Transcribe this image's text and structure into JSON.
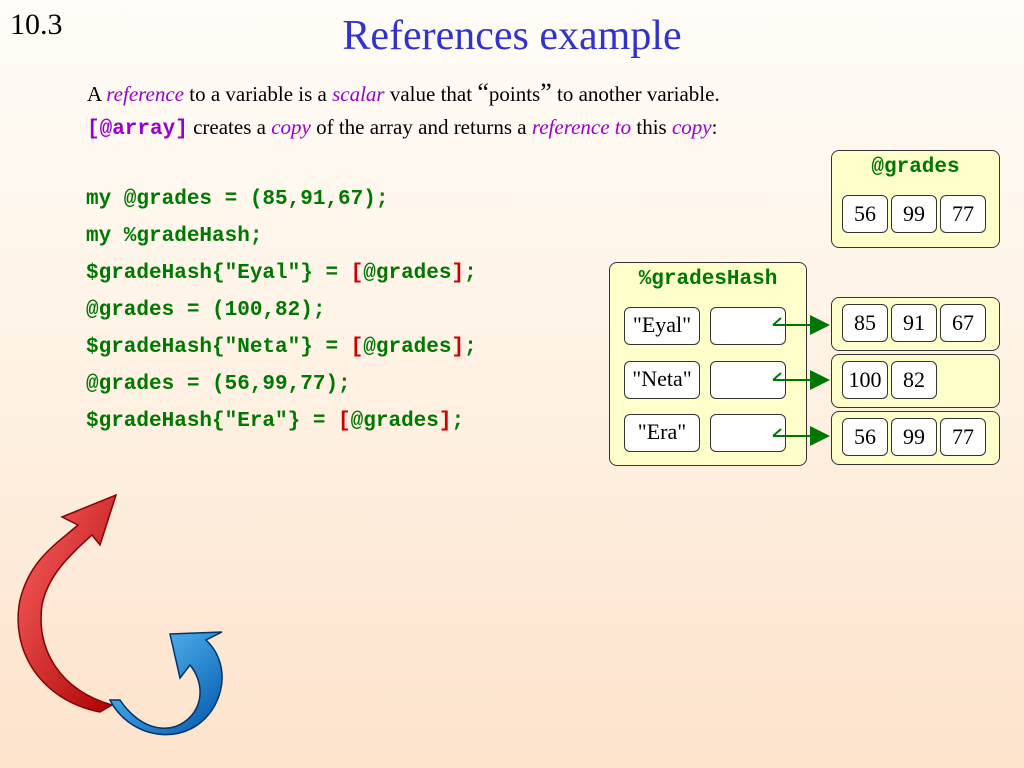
{
  "slide": {
    "number": "10.3",
    "title": "References example"
  },
  "intro": {
    "l1_a": "A ",
    "l1_reference": "reference",
    "l1_b": " to a variable is a ",
    "l1_scalar": "scalar",
    "l1_c": " value that ",
    "l1_open_quote": "“",
    "l1_points": "points",
    "l1_close_quote": "”",
    "l1_d": " to another variable.",
    "l2_code": "[@array]",
    "l2_a": " creates a ",
    "l2_copy": "copy",
    "l2_b": " of the array and returns a ",
    "l2_reference_to": "reference to",
    "l2_c": " this ",
    "l2_copy2": "copy",
    "l2_colon": ":"
  },
  "code": {
    "line1": "my @grades = (85,91,67);",
    "line2": "my %gradeHash;",
    "line3_a": "$gradeHash{\"Eyal\"} = ",
    "line5_a": "$gradeHash{\"Neta\"} = ",
    "line7_a": "$gradeHash{\"Era\"} = ",
    "open_bracket": "[",
    "at_grades": "@grades",
    "close_bracket": "]",
    "semicolon": ";",
    "line4": "@grades = (100,82);",
    "line6": "@grades = (56,99,77);"
  },
  "grades_box": {
    "title": "@grades",
    "values": [
      "56",
      "99",
      "77"
    ]
  },
  "hash_box": {
    "title": "%gradesHash",
    "keys": [
      "\"Eyal\"",
      "\"Neta\"",
      "\"Era\""
    ]
  },
  "arrays": [
    [
      "85",
      "91",
      "67"
    ],
    [
      "100",
      "82"
    ],
    [
      "56",
      "99",
      "77"
    ]
  ],
  "colors": {
    "title": "#3333cc",
    "emphasis": "#9900cc",
    "code": "#007700",
    "bracket": "#cc0000",
    "box_fill": "#ffffcc",
    "arrow": "#007700"
  },
  "decoration": [
    "red-curved-arrow-icon",
    "blue-curved-arrow-icon"
  ]
}
